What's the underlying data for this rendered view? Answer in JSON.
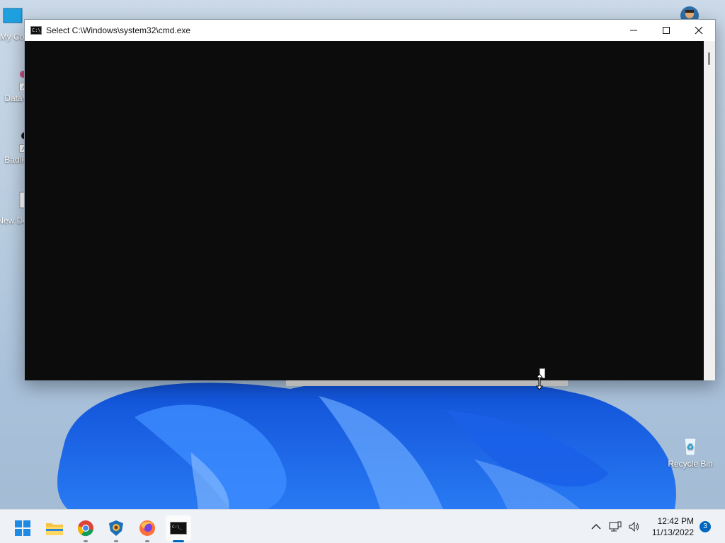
{
  "desktop": {
    "icons": [
      {
        "label": "My Co"
      },
      {
        "label": "DataV"
      },
      {
        "label": "Badlio"
      },
      {
        "label": "New Docu"
      },
      {
        "label": "Recycle Bin"
      }
    ]
  },
  "window": {
    "title": "Select C:\\Windows\\system32\\cmd.exe",
    "icon": "cmd-icon",
    "controls": [
      "minimize-icon",
      "maximize-icon",
      "close-icon"
    ]
  },
  "taskbar": {
    "apps": [
      {
        "name": "start",
        "icon": "windows-start-icon"
      },
      {
        "name": "file-explorer",
        "icon": "folder-icon"
      },
      {
        "name": "chrome",
        "icon": "chrome-icon"
      },
      {
        "name": "brave-lion",
        "icon": "shield-lion-icon"
      },
      {
        "name": "firefox",
        "icon": "firefox-icon"
      },
      {
        "name": "cmd",
        "icon": "terminal-icon"
      }
    ],
    "time": "12:42 PM",
    "date": "11/13/2022",
    "notifications": "3"
  },
  "colors": {
    "console_bg": "#0c0c0c",
    "accent": "#0067c0"
  }
}
